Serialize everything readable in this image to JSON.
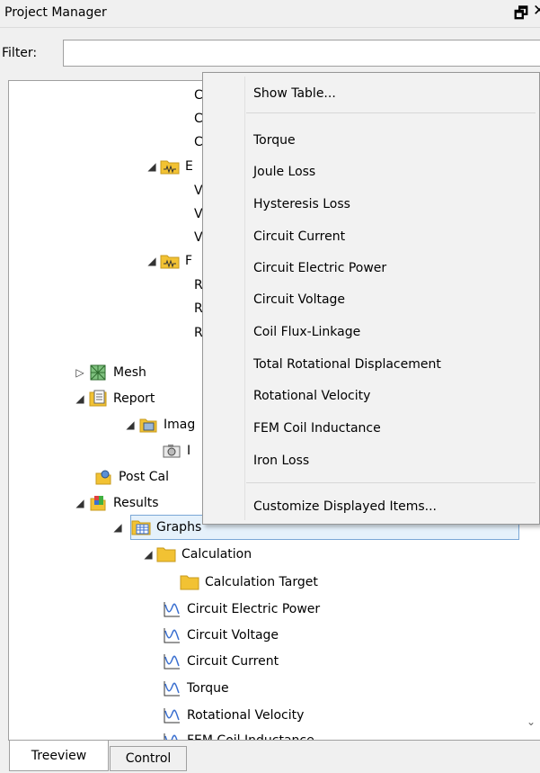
{
  "window": {
    "title": "Project Manager",
    "float_glyph": "🗗",
    "close_glyph": "✕"
  },
  "filter": {
    "label": "Filter:",
    "value": ""
  },
  "tree": {
    "items": [
      {
        "label": "C",
        "icon": null,
        "arrow": null
      },
      {
        "label": "C",
        "icon": null,
        "arrow": null
      },
      {
        "label": "C",
        "icon": null,
        "arrow": null
      },
      {
        "label": "E",
        "icon": "circuit-folder-icon",
        "arrow": "expanded"
      },
      {
        "label": "V",
        "icon": null,
        "arrow": null
      },
      {
        "label": "V",
        "icon": null,
        "arrow": null
      },
      {
        "label": "V",
        "icon": null,
        "arrow": null
      },
      {
        "label": "F",
        "icon": "circuit-folder-icon",
        "arrow": "expanded"
      },
      {
        "label": "R",
        "icon": null,
        "arrow": null
      },
      {
        "label": "R",
        "icon": null,
        "arrow": null
      },
      {
        "label": "R",
        "icon": null,
        "arrow": null
      },
      {
        "label": "Mesh",
        "icon": "mesh-icon",
        "arrow": "collapsed"
      },
      {
        "label": "Report",
        "icon": "report-icon",
        "arrow": "expanded"
      },
      {
        "label": "Imag",
        "icon": "image-folder-icon",
        "arrow": "expanded"
      },
      {
        "label": "I",
        "icon": "camera-icon",
        "arrow": null
      },
      {
        "label": "Post Cal",
        "icon": "post-calc-icon",
        "arrow": null
      },
      {
        "label": "Results",
        "icon": "results-icon",
        "arrow": "expanded"
      },
      {
        "label": "Graphs",
        "icon": "graphs-icon",
        "arrow": "expanded"
      },
      {
        "label": "Calculation",
        "icon": "folder-icon",
        "arrow": "expanded"
      },
      {
        "label": "Calculation Target",
        "icon": "folder-icon",
        "arrow": null
      },
      {
        "label": "Circuit Electric Power",
        "icon": "graph-icon",
        "arrow": null
      },
      {
        "label": "Circuit Voltage",
        "icon": "graph-icon",
        "arrow": null
      },
      {
        "label": "Circuit Current",
        "icon": "graph-icon",
        "arrow": null
      },
      {
        "label": "Torque",
        "icon": "graph-icon",
        "arrow": null
      },
      {
        "label": "Rotational Velocity",
        "icon": "graph-icon",
        "arrow": null
      },
      {
        "label": "FEM Coil Inductance",
        "icon": "graph-icon",
        "arrow": null
      }
    ],
    "selected": "Graphs"
  },
  "tabs": {
    "treeview": "Treeview",
    "control": "Control"
  },
  "context_menu": {
    "items": [
      {
        "label": "Show Table...",
        "submenu": false
      },
      {
        "label": "Torque",
        "submenu": true
      },
      {
        "label": "Joule Loss",
        "submenu": true
      },
      {
        "label": "Hysteresis Loss",
        "submenu": true
      },
      {
        "label": "Circuit Current",
        "submenu": true
      },
      {
        "label": "Circuit Electric Power",
        "submenu": true
      },
      {
        "label": "Circuit Voltage",
        "submenu": true
      },
      {
        "label": "Coil Flux-Linkage",
        "submenu": true
      },
      {
        "label": "Total Rotational Displacement",
        "submenu": true
      },
      {
        "label": "Rotational Velocity",
        "submenu": true
      },
      {
        "label": "FEM Coil Inductance",
        "submenu": true
      },
      {
        "label": "Iron Loss",
        "submenu": true
      },
      {
        "label": "Customize Displayed Items...",
        "submenu": false
      }
    ],
    "submenu_glyph": "▶"
  },
  "colors": {
    "folder": "#f2c233",
    "graph_line": "#3a6fd0",
    "selection_border": "#7aa7d6",
    "selection_bg": "#e5f1fb"
  }
}
